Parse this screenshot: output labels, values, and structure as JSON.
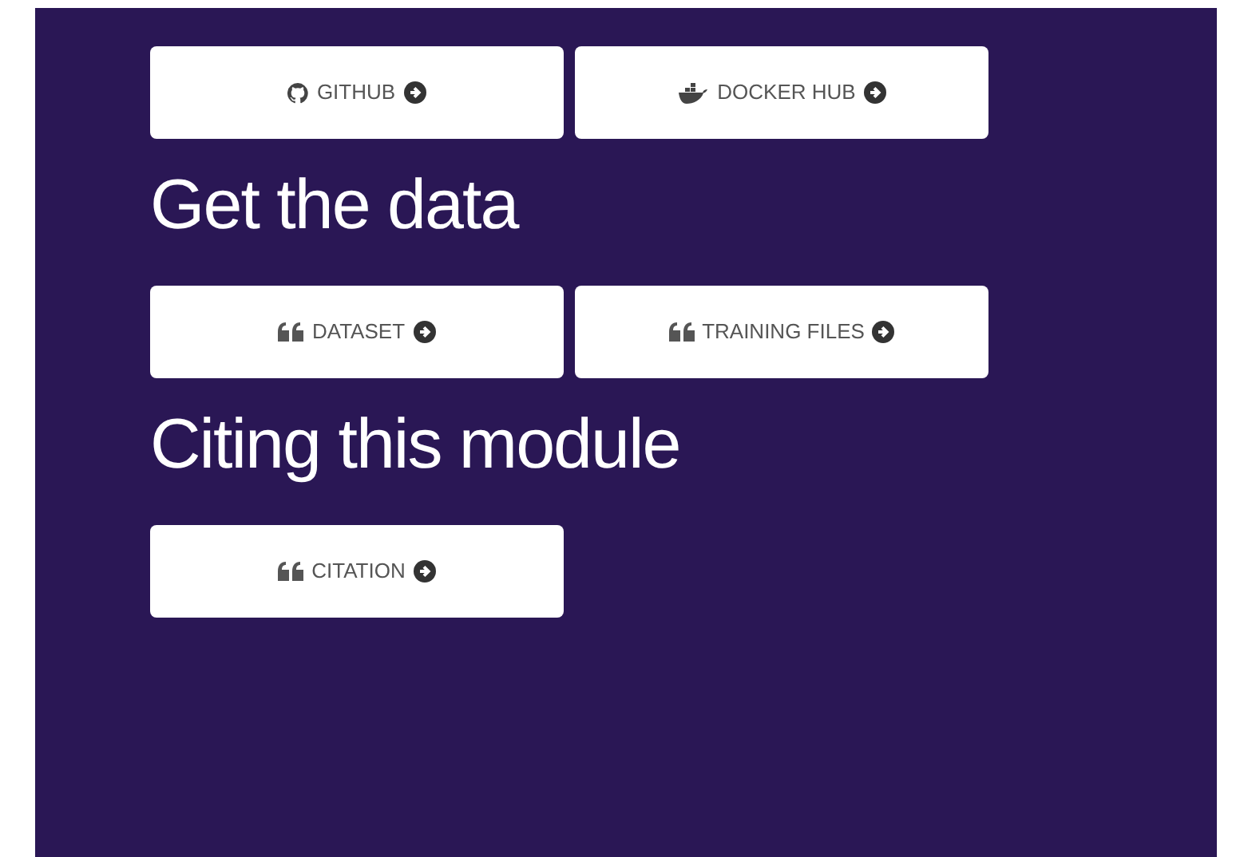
{
  "sections": [
    {
      "buttons": [
        {
          "label": "GITHUB",
          "kind": "github"
        },
        {
          "label": "DOCKER HUB",
          "kind": "docker"
        }
      ]
    },
    {
      "heading": "Get the data",
      "buttons": [
        {
          "label": "DATASET",
          "kind": "quote"
        },
        {
          "label": "TRAINING FILES",
          "kind": "quote"
        }
      ]
    },
    {
      "heading": "Citing this module",
      "buttons": [
        {
          "label": "CITATION",
          "kind": "quote"
        }
      ]
    }
  ]
}
